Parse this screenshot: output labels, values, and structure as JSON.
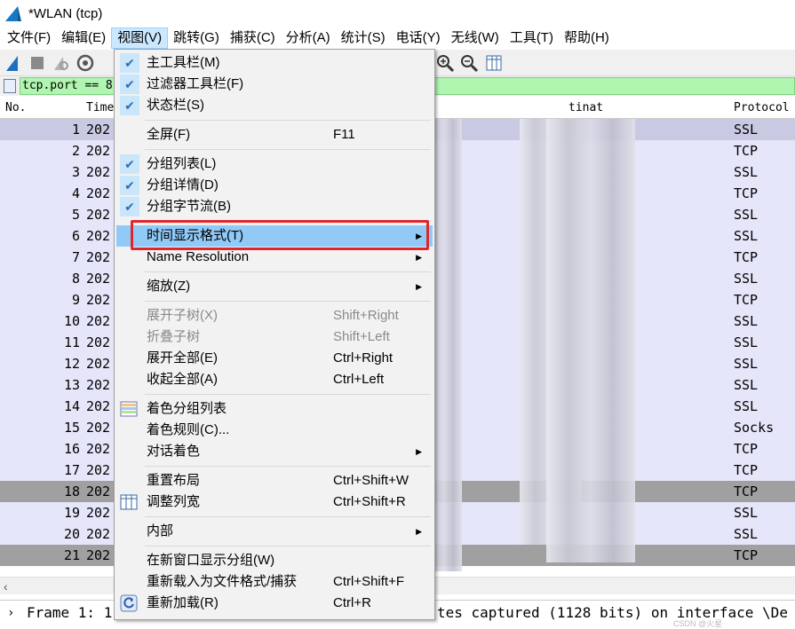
{
  "window": {
    "title": "*WLAN (tcp)"
  },
  "menubar": [
    {
      "label": "文件(F)",
      "active": false
    },
    {
      "label": "编辑(E)",
      "active": false
    },
    {
      "label": "视图(V)",
      "active": true
    },
    {
      "label": "跳转(G)",
      "active": false
    },
    {
      "label": "捕获(C)",
      "active": false
    },
    {
      "label": "分析(A)",
      "active": false
    },
    {
      "label": "统计(S)",
      "active": false
    },
    {
      "label": "电话(Y)",
      "active": false
    },
    {
      "label": "无线(W)",
      "active": false
    },
    {
      "label": "工具(T)",
      "active": false
    },
    {
      "label": "帮助(H)",
      "active": false
    }
  ],
  "filter": {
    "value": "tcp.port == 8"
  },
  "columns": {
    "no": "No.",
    "time": "Time",
    "destination": "tinat",
    "protocol": "Protocol"
  },
  "rows": [
    {
      "no": "1",
      "time": "202",
      "protocol": "SSL",
      "bg": "#c9c9e3"
    },
    {
      "no": "2",
      "time": "202",
      "protocol": "TCP",
      "bg": "#e6e6fa"
    },
    {
      "no": "3",
      "time": "202",
      "protocol": "SSL",
      "bg": "#e6e6fa"
    },
    {
      "no": "4",
      "time": "202",
      "protocol": "TCP",
      "bg": "#e6e6fa"
    },
    {
      "no": "5",
      "time": "202",
      "protocol": "SSL",
      "bg": "#e6e6fa"
    },
    {
      "no": "6",
      "time": "202",
      "protocol": "SSL",
      "bg": "#e6e6fa"
    },
    {
      "no": "7",
      "time": "202",
      "protocol": "TCP",
      "bg": "#e6e6fa"
    },
    {
      "no": "8",
      "time": "202",
      "protocol": "SSL",
      "bg": "#e6e6fa"
    },
    {
      "no": "9",
      "time": "202",
      "protocol": "TCP",
      "bg": "#e6e6fa"
    },
    {
      "no": "10",
      "time": "202",
      "protocol": "SSL",
      "bg": "#e6e6fa"
    },
    {
      "no": "11",
      "time": "202",
      "protocol": "SSL",
      "bg": "#e6e6fa"
    },
    {
      "no": "12",
      "time": "202",
      "protocol": "SSL",
      "bg": "#e6e6fa"
    },
    {
      "no": "13",
      "time": "202",
      "protocol": "SSL",
      "bg": "#e6e6fa"
    },
    {
      "no": "14",
      "time": "202",
      "protocol": "SSL",
      "bg": "#e6e6fa"
    },
    {
      "no": "15",
      "time": "202",
      "protocol": "Socks",
      "bg": "#e6e6fa"
    },
    {
      "no": "16",
      "time": "202",
      "protocol": "TCP",
      "bg": "#e6e6fa"
    },
    {
      "no": "17",
      "time": "202",
      "protocol": "TCP",
      "bg": "#e6e6fa"
    },
    {
      "no": "18",
      "time": "202",
      "protocol": "TCP",
      "bg": "#a0a0a0"
    },
    {
      "no": "19",
      "time": "202",
      "protocol": "SSL",
      "bg": "#e6e6fa"
    },
    {
      "no": "20",
      "time": "202",
      "protocol": "SSL",
      "bg": "#e6e6fa"
    },
    {
      "no": "21",
      "time": "202",
      "protocol": "TCP",
      "bg": "#a0a0a0"
    }
  ],
  "detail": {
    "line_left": "Frame 1: 1",
    "line_right": "tes captured (1128 bits) on interface \\De"
  },
  "watermark": "CSDN @火星",
  "view_menu": [
    {
      "label": "主工具栏(M)",
      "checked": true
    },
    {
      "label": "过滤器工具栏(F)",
      "checked": true
    },
    {
      "label": "状态栏(S)",
      "checked": true
    },
    {
      "sep": true
    },
    {
      "label": "全屏(F)",
      "shortcut": "F11"
    },
    {
      "sep": true
    },
    {
      "label": "分组列表(L)",
      "checked": true
    },
    {
      "label": "分组详情(D)",
      "checked": true
    },
    {
      "label": "分组字节流(B)",
      "checked": true
    },
    {
      "sep": true
    },
    {
      "label": "时间显示格式(T)",
      "submenu": true,
      "highlight": true
    },
    {
      "label": "Name Resolution",
      "submenu": true
    },
    {
      "sep": true
    },
    {
      "label": "缩放(Z)",
      "submenu": true
    },
    {
      "sep": true
    },
    {
      "label": "展开子树(X)",
      "shortcut": "Shift+Right",
      "disabled": true
    },
    {
      "label": "折叠子树",
      "shortcut": "Shift+Left",
      "disabled": true
    },
    {
      "label": "展开全部(E)",
      "shortcut": "Ctrl+Right"
    },
    {
      "label": "收起全部(A)",
      "shortcut": "Ctrl+Left"
    },
    {
      "sep": true
    },
    {
      "label": "着色分组列表",
      "icon": "colorize-icon"
    },
    {
      "label": "着色规则(C)..."
    },
    {
      "label": "对话着色",
      "submenu": true
    },
    {
      "sep": true
    },
    {
      "label": "重置布局",
      "shortcut": "Ctrl+Shift+W"
    },
    {
      "label": "调整列宽",
      "shortcut": "Ctrl+Shift+R",
      "icon": "resize-columns-icon"
    },
    {
      "sep": true
    },
    {
      "label": "内部",
      "submenu": true
    },
    {
      "sep": true
    },
    {
      "label": "在新窗口显示分组(W)"
    },
    {
      "label": "重新载入为文件格式/捕获",
      "shortcut": "Ctrl+Shift+F"
    },
    {
      "label": "重新加载(R)",
      "shortcut": "Ctrl+R",
      "icon": "reload-icon"
    }
  ]
}
